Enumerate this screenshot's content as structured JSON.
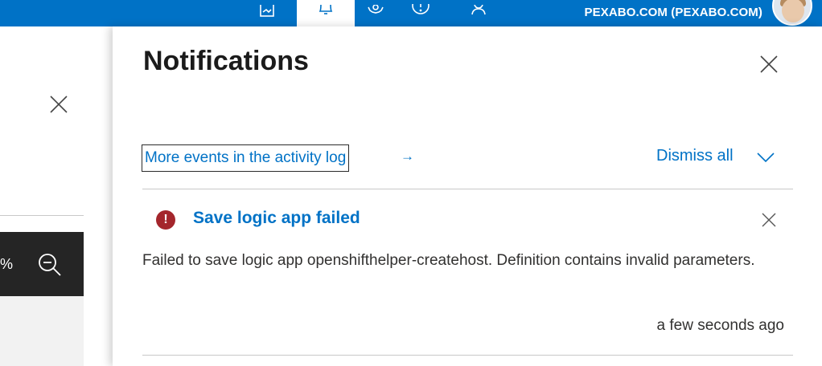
{
  "topbar": {
    "account_label": "PEXABO.COM (PEXABO.COM)",
    "icons": [
      "feedback-icon",
      "bell-icon",
      "gear-icon",
      "help-icon",
      "person-icon"
    ],
    "accent": "#0072c6"
  },
  "left_blade": {
    "zoom_percent_fragment": "%"
  },
  "notifications": {
    "title": "Notifications",
    "activity_link": "More events in the activity log",
    "activity_arrow": "→",
    "dismiss_all": "Dismiss all",
    "items": [
      {
        "status": "error",
        "status_color": "#a4262c",
        "title": "Save logic app failed",
        "body": "Failed to save logic app openshifthelper-createhost. Definition contains invalid parameters.",
        "time": "a few seconds ago"
      }
    ]
  }
}
